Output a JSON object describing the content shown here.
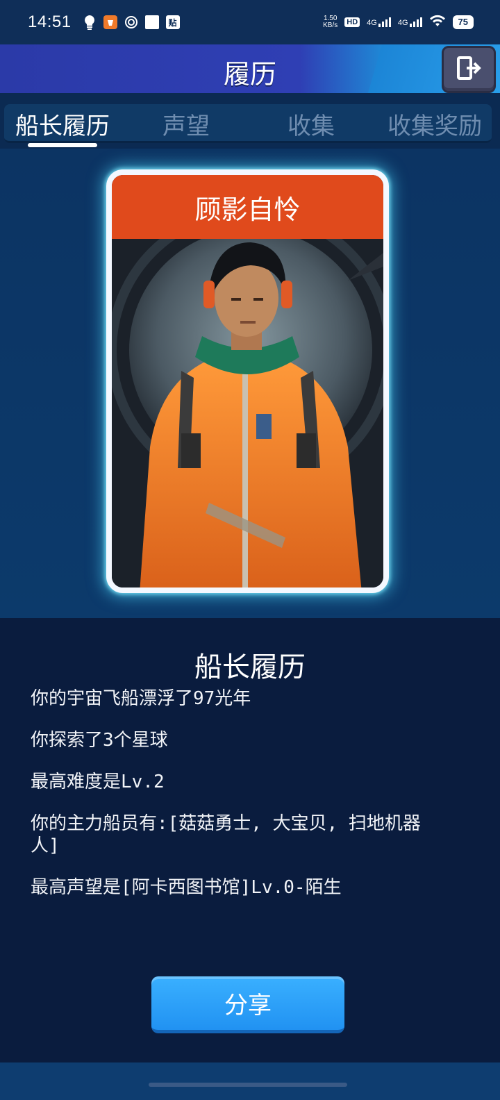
{
  "status_bar": {
    "time": "14:51",
    "net_speed_value": "1.50",
    "net_speed_unit": "KB/s",
    "hd_label": "HD",
    "signal1_label": "4G",
    "signal2_label": "4G",
    "battery": "75",
    "tie_icon_text": "贴"
  },
  "header": {
    "title": "履历"
  },
  "tabs": [
    {
      "label": "船长履历"
    },
    {
      "label": "声望"
    },
    {
      "label": "收集"
    },
    {
      "label": "收集奖励"
    }
  ],
  "card": {
    "title": "顾影自怜"
  },
  "profile": {
    "section_title": "船长履历",
    "lines": [
      "你的宇宙飞船漂浮了97光年",
      "你探索了3个星球",
      "最高难度是Lv.2",
      "你的主力船员有:[菇菇勇士, 大宝贝, 扫地机器人]",
      "最高声望是[阿卡西图书馆]Lv.0-陌生"
    ]
  },
  "share_button": {
    "label": "分享"
  },
  "colors": {
    "header_left": "#2b3aa8",
    "header_right": "#1d9ae6",
    "card_title_bar": "#e04a1c",
    "card_glow": "#50dcff",
    "share_button": "#2192f2",
    "lower_panel": "#0a1c3e"
  },
  "icons": {
    "exit": "exit-door-icon",
    "bulb": "lightbulb-icon",
    "wifi": "wifi-icon"
  }
}
